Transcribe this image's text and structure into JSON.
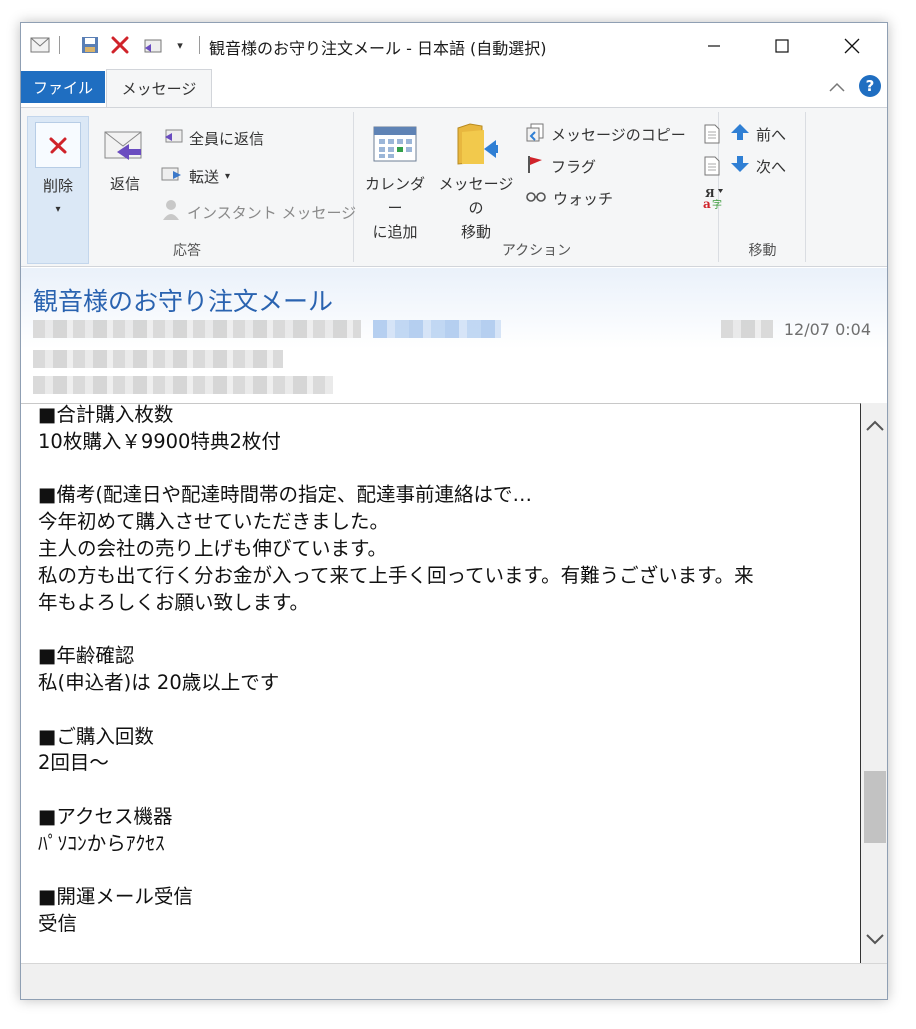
{
  "window": {
    "title": "観音様のお守り注文メール - 日本語 (自動選択)"
  },
  "tabs": {
    "file": "ファイル",
    "message": "メッセージ"
  },
  "ribbon": {
    "delete": "削除",
    "delete_arrow": "▾",
    "reply": "返信",
    "reply_all": "全員に返信",
    "forward": "転送",
    "forward_arrow": "▾",
    "instant_message": "インスタント メッセージ",
    "group_respond": "応答",
    "calendar_line1": "カレンダー",
    "calendar_line2": "に追加",
    "move_line1": "メッセージの",
    "move_line2": "移動",
    "copy_message": "メッセージのコピー",
    "flag": "フラグ",
    "watch": "ウォッチ",
    "group_actions": "アクション",
    "prev": "前へ",
    "next": "次へ",
    "group_move": "移動"
  },
  "header": {
    "subject": "観音様のお守り注文メール",
    "datetime": "12/07 0:04"
  },
  "body": {
    "lines": [
      "■合計購入枚数",
      "10枚購入￥9900特典2枚付",
      "",
      "■備考(配達日や配達時間帯の指定、配達事前連絡はで…",
      "今年初めて購入させていただきました。",
      "主人の会社の売り上げも伸びています。",
      "私の方も出て行く分お金が入って来て上手く回っています。有難うございます。来",
      "年もよろしくお願い致します。",
      "",
      "■年齢確認",
      "私(申込者)は 20歳以上です",
      "",
      "■ご購入回数",
      "2回目～",
      "",
      "■アクセス機器",
      "ﾊﾟｿｺﾝからｱｸｾｽ",
      "",
      "■開運メール受信",
      "受信"
    ]
  },
  "colors": {
    "accent": "#1f6ec1",
    "subject": "#2a63b0"
  }
}
